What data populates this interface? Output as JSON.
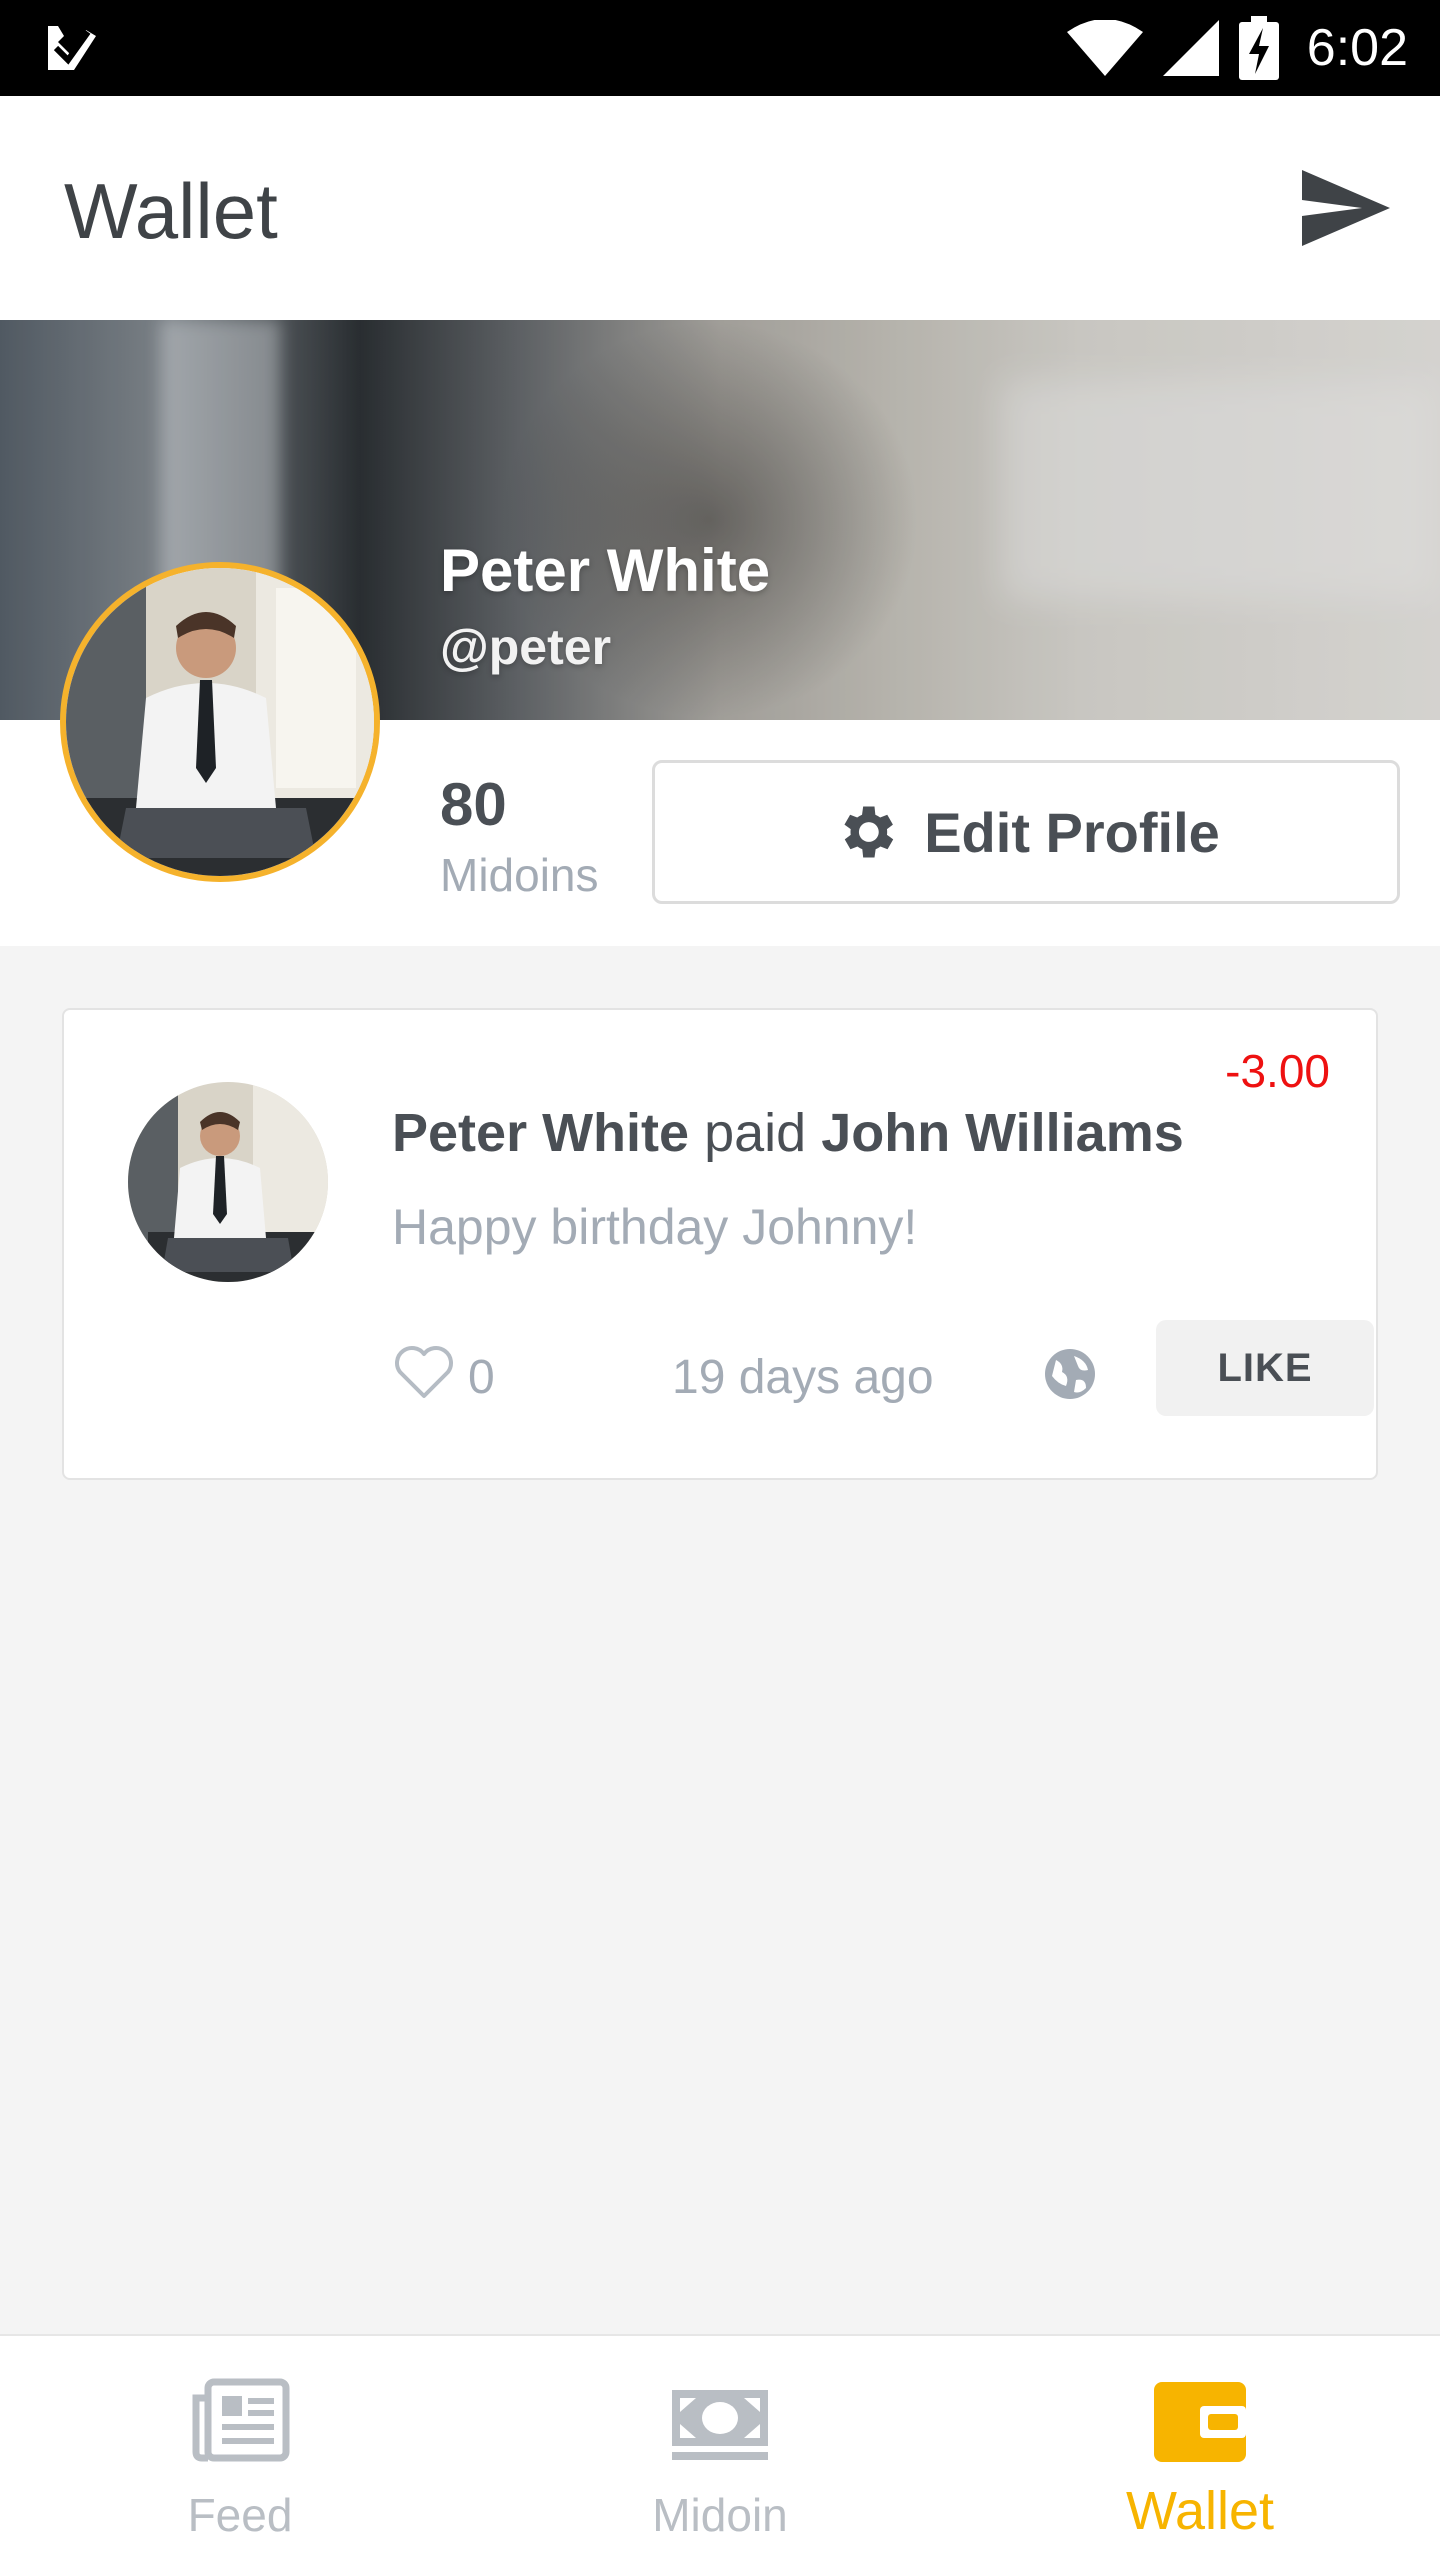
{
  "status_bar": {
    "time": "6:02",
    "icons": [
      "app-notification-icon",
      "wifi-icon",
      "signal-icon",
      "battery-charging-icon"
    ]
  },
  "app_bar": {
    "title": "Wallet",
    "action_icon": "send-icon"
  },
  "profile": {
    "name": "Peter White",
    "handle": "@peter",
    "balance": "80",
    "balance_label": "Midoins",
    "edit_button": "Edit Profile",
    "edit_icon": "gear-icon",
    "ring_color": "#f5b22c"
  },
  "feed": {
    "items": [
      {
        "payer": "Peter White",
        "verb": "paid",
        "payee": "John Williams",
        "message": "Happy birthday Johnny!",
        "amount": "-3.00",
        "amount_color": "#ee1111",
        "likes": "0",
        "time_ago": "19 days ago",
        "visibility_icon": "globe-icon",
        "like_button": "LIKE"
      }
    ]
  },
  "bottom_nav": {
    "items": [
      {
        "label": "Feed",
        "icon": "newspaper-icon",
        "active": false
      },
      {
        "label": "Midoin",
        "icon": "money-icon",
        "active": false
      },
      {
        "label": "Wallet",
        "icon": "wallet-icon",
        "active": true
      }
    ],
    "active_color": "#f7b400"
  }
}
